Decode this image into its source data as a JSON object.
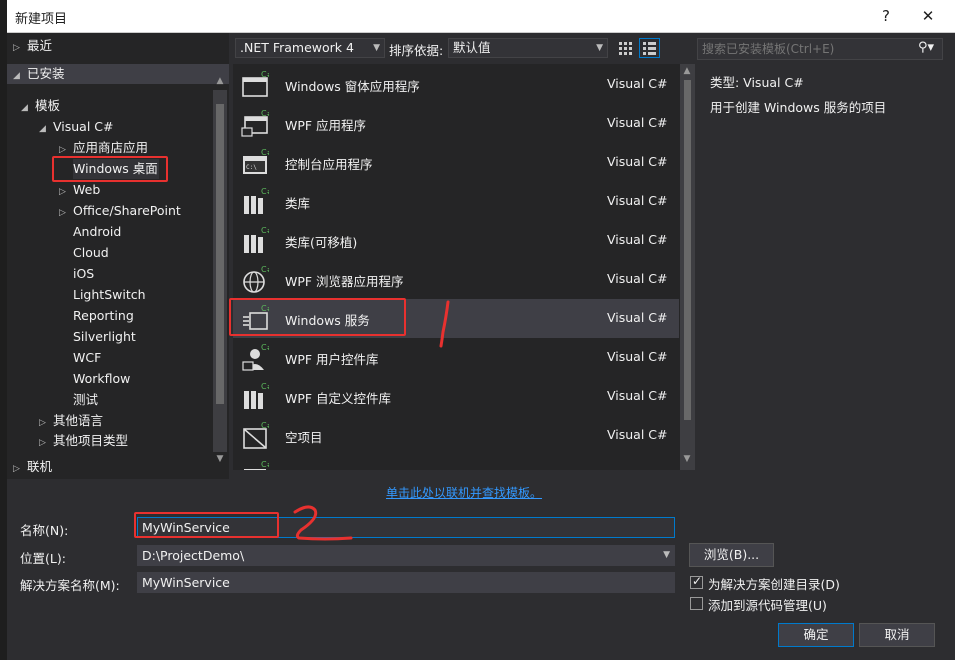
{
  "dialog": {
    "title": "新建项目",
    "help_label": "?",
    "close_label": "✕"
  },
  "tree": {
    "recent": "最近",
    "installed": "已安装",
    "templates": "模板",
    "visual_csharp": "Visual C#",
    "children": [
      "应用商店应用",
      "Windows 桌面",
      "Web",
      "Office/SharePoint",
      "Android",
      "Cloud",
      "iOS",
      "LightSwitch",
      "Reporting",
      "Silverlight",
      "WCF",
      "Workflow",
      "测试"
    ],
    "other_languages": "其他语言",
    "other_project_types": "其他项目类型",
    "online": "联机"
  },
  "toolbar": {
    "framework": ".NET Framework 4",
    "sort_label": "排序依据:",
    "sort_value": "默认值"
  },
  "templates": [
    {
      "name": "Windows 窗体应用程序",
      "lang": "Visual C#",
      "icon": "windows-form-icon"
    },
    {
      "name": "WPF 应用程序",
      "lang": "Visual C#",
      "icon": "wpf-app-icon"
    },
    {
      "name": "控制台应用程序",
      "lang": "Visual C#",
      "icon": "console-app-icon"
    },
    {
      "name": "类库",
      "lang": "Visual C#",
      "icon": "class-library-icon"
    },
    {
      "name": "类库(可移植)",
      "lang": "Visual C#",
      "icon": "portable-library-icon"
    },
    {
      "name": "WPF 浏览器应用程序",
      "lang": "Visual C#",
      "icon": "wpf-browser-icon"
    },
    {
      "name": "Windows 服务",
      "lang": "Visual C#",
      "icon": "windows-service-icon"
    },
    {
      "name": "WPF 用户控件库",
      "lang": "Visual C#",
      "icon": "wpf-user-control-icon"
    },
    {
      "name": "WPF 自定义控件库",
      "lang": "Visual C#",
      "icon": "wpf-custom-control-icon"
    },
    {
      "name": "空项目",
      "lang": "Visual C#",
      "icon": "empty-project-icon"
    }
  ],
  "search": {
    "placeholder": "搜索已安装模板(Ctrl+E)"
  },
  "details": {
    "type": "类型:  Visual C#",
    "description": "用于创建 Windows 服务的项目"
  },
  "online_link": "单击此处以联机并查找模板。",
  "form": {
    "name_label": "名称(N):",
    "name_value": "MyWinService",
    "location_label": "位置(L):",
    "location_value": "D:\\ProjectDemo\\",
    "solution_label": "解决方案名称(M):",
    "solution_value": "MyWinService",
    "browse_label": "浏览(B)...",
    "create_dir_label": "为解决方案创建目录(D)",
    "create_dir_checked": true,
    "source_control_label": "添加到源代码管理(U)",
    "source_control_checked": false,
    "ok_label": "确定",
    "cancel_label": "取消"
  },
  "colors": {
    "annotation": "#e8312f",
    "accent": "#007acc",
    "link": "#3399ff"
  }
}
